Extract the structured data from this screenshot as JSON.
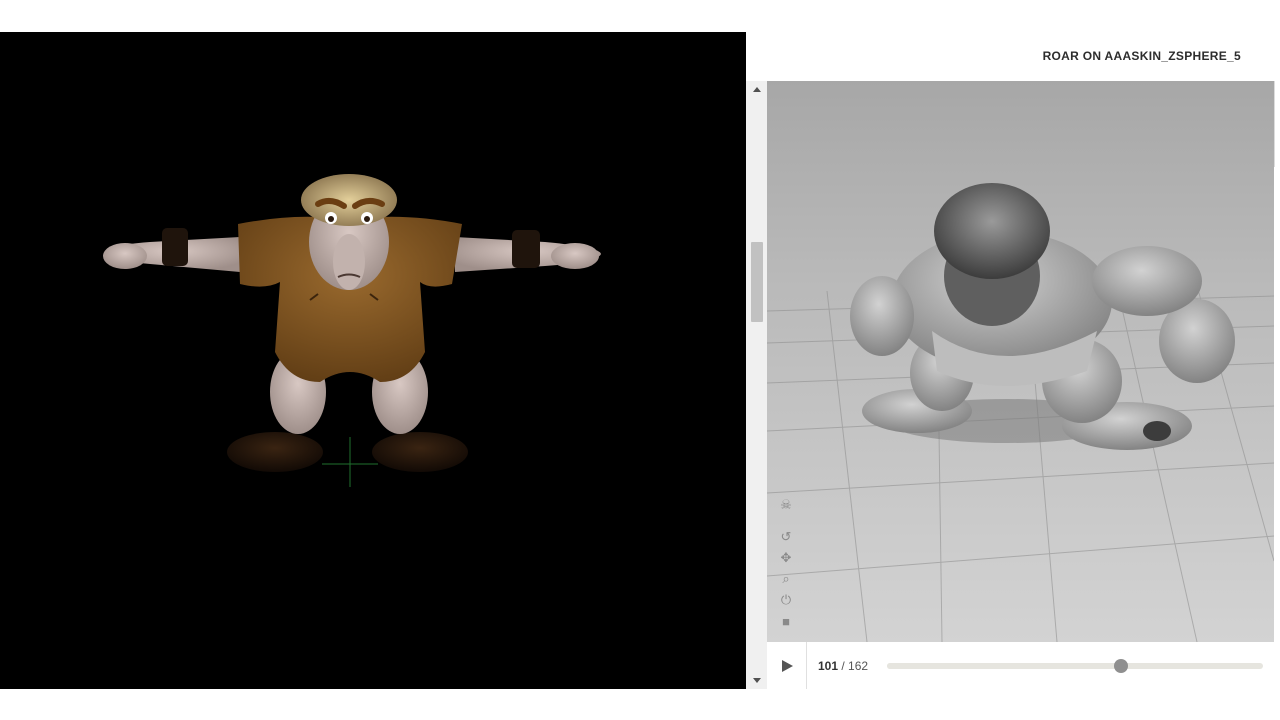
{
  "right_panel": {
    "title": "ROAR ON AAASKIN_ZSPHERE_5"
  },
  "viewer_tools": [
    {
      "name": "skull-icon",
      "glyph": "☠"
    },
    {
      "name": "rotate-icon",
      "glyph": "↺"
    },
    {
      "name": "pan-icon",
      "glyph": "✥"
    },
    {
      "name": "zoom-icon",
      "glyph": "⌕"
    },
    {
      "name": "reset-icon",
      "glyph": "⏻"
    },
    {
      "name": "camera-icon",
      "glyph": "■"
    }
  ],
  "player": {
    "current_frame": "101",
    "separator": " / ",
    "total_frames": "162",
    "progress": 0.623
  },
  "colors": {
    "left_viewport_bg": "#000000",
    "viewer_floor": "#c9c9c9",
    "character_skin_left": "#c9b9b4",
    "character_tunic": "#8a5a22",
    "model_grey": "#a9a9a9",
    "timeline_handle": "#8f8f8f"
  }
}
